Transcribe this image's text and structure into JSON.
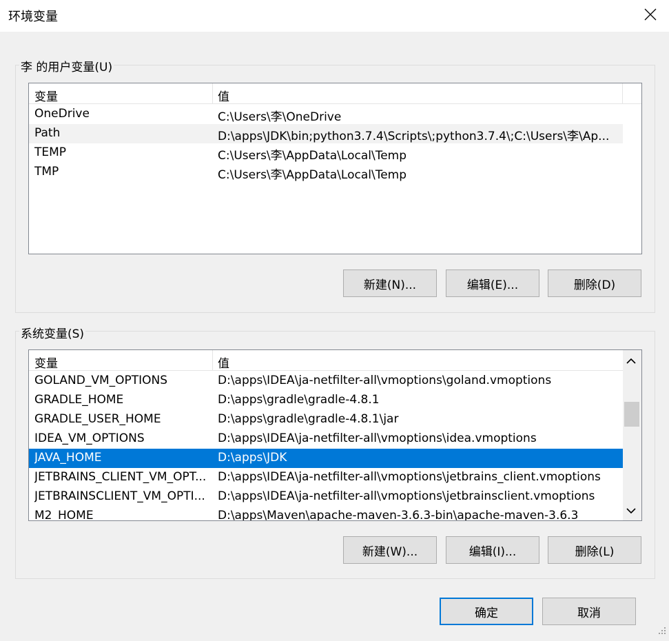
{
  "window": {
    "title": "环境变量"
  },
  "user_vars": {
    "group_label": "李 的用户变量(U)",
    "columns": [
      "变量",
      "值"
    ],
    "rows": [
      {
        "name": "OneDrive",
        "value": "C:\\Users\\李\\OneDrive"
      },
      {
        "name": "Path",
        "value": "D:\\apps\\JDK\\bin;python3.7.4\\Scripts\\;python3.7.4\\;C:\\Users\\李\\Ap..."
      },
      {
        "name": "TEMP",
        "value": "C:\\Users\\李\\AppData\\Local\\Temp"
      },
      {
        "name": "TMP",
        "value": "C:\\Users\\李\\AppData\\Local\\Temp"
      }
    ],
    "buttons": {
      "new": "新建(N)...",
      "edit": "编辑(E)...",
      "delete": "删除(D)"
    }
  },
  "system_vars": {
    "group_label": "系统变量(S)",
    "columns": [
      "变量",
      "值"
    ],
    "rows": [
      {
        "name": "GOLAND_VM_OPTIONS",
        "value": "D:\\apps\\IDEA\\ja-netfilter-all\\vmoptions\\goland.vmoptions"
      },
      {
        "name": "GRADLE_HOME",
        "value": "D:\\apps\\gradle\\gradle-4.8.1"
      },
      {
        "name": "GRADLE_USER_HOME",
        "value": "D:\\apps\\gradle\\gradle-4.8.1\\jar"
      },
      {
        "name": "IDEA_VM_OPTIONS",
        "value": "D:\\apps\\IDEA\\ja-netfilter-all\\vmoptions\\idea.vmoptions"
      },
      {
        "name": "JAVA_HOME",
        "value": "D:\\apps\\JDK"
      },
      {
        "name": "JETBRAINS_CLIENT_VM_OPT...",
        "value": "D:\\apps\\IDEA\\ja-netfilter-all\\vmoptions\\jetbrains_client.vmoptions"
      },
      {
        "name": "JETBRAINSCLIENT_VM_OPTI...",
        "value": "D:\\apps\\IDEA\\ja-netfilter-all\\vmoptions\\jetbrainsclient.vmoptions"
      },
      {
        "name": "M2_HOME",
        "value": "D:\\apps\\Maven\\apache-maven-3.6.3-bin\\apache-maven-3.6.3"
      }
    ],
    "selected": "JAVA_HOME",
    "buttons": {
      "new": "新建(W)...",
      "edit": "编辑(I)...",
      "delete": "删除(L)"
    }
  },
  "footer": {
    "ok": "确定",
    "cancel": "取消"
  },
  "colors": {
    "selection": "#0078d7",
    "accent_border": "#0078d7"
  },
  "icons": [
    "close-icon",
    "chevron-up-icon",
    "chevron-down-icon",
    "resize-grip-icon"
  ]
}
